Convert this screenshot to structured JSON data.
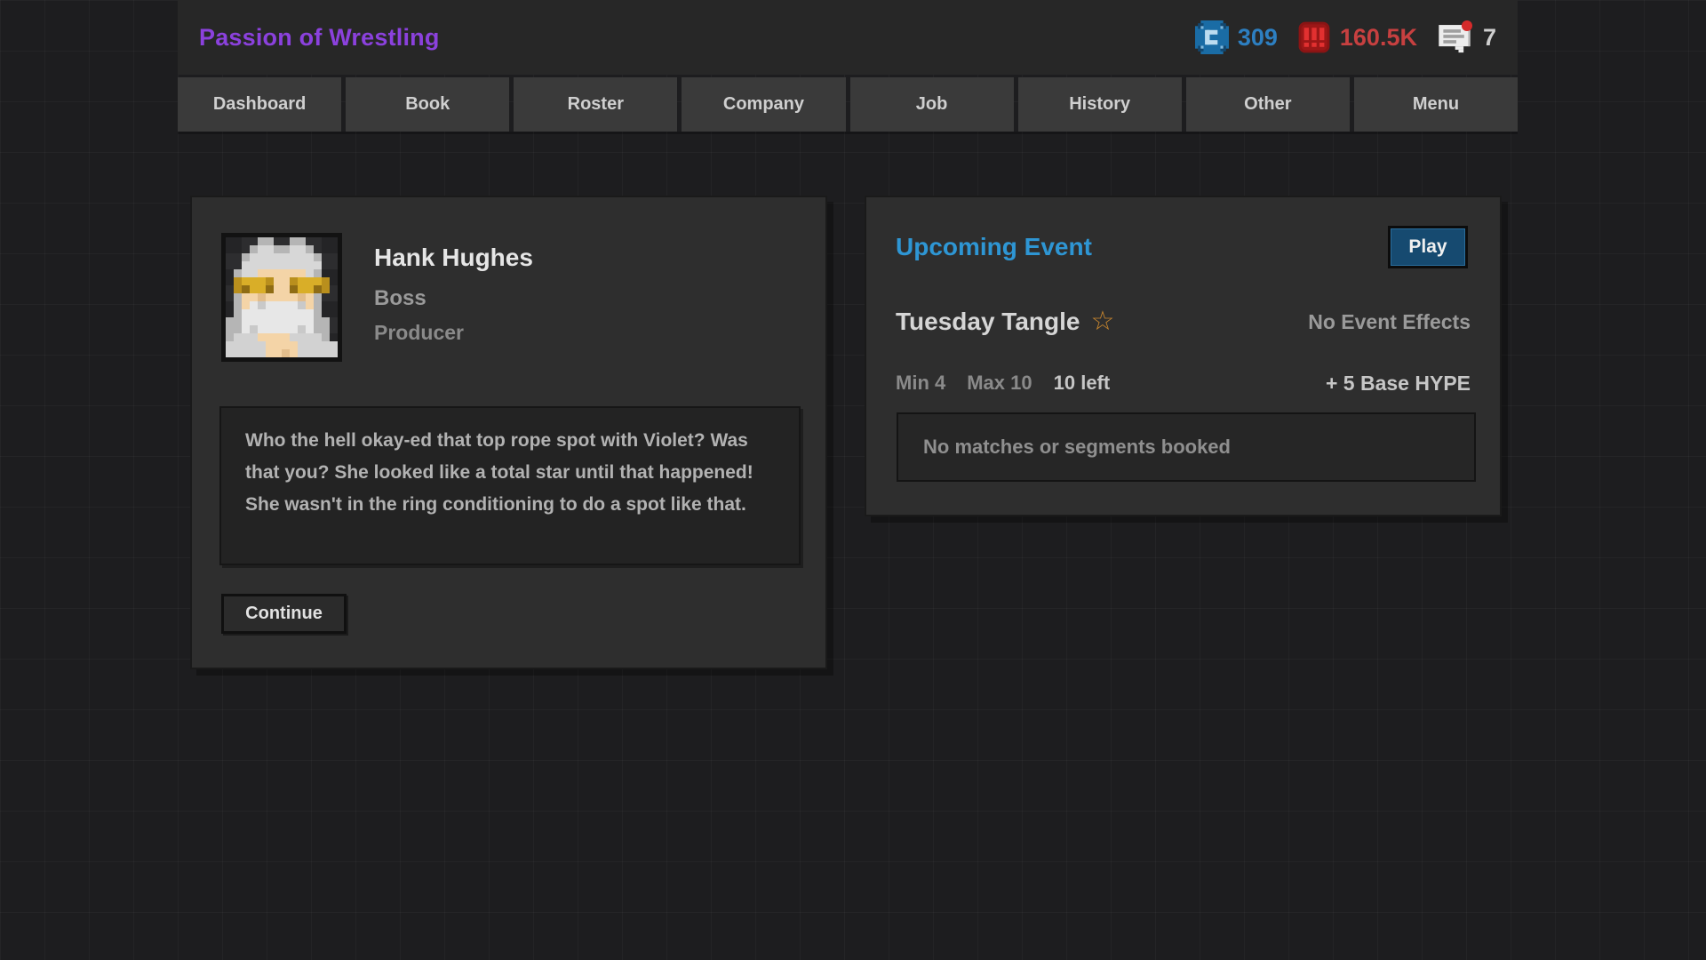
{
  "app": {
    "title": "Passion of Wrestling",
    "accent_purple": "#8b41dd",
    "accent_blue": "#2e96d4",
    "accent_red": "#c74040"
  },
  "header": {
    "tabs": [
      "Dashboard",
      "Book",
      "Roster",
      "Company",
      "Job",
      "History",
      "Other",
      "Menu"
    ],
    "stats": {
      "coins": {
        "icon": "coin-icon",
        "value": "309",
        "color": "#2d7fc1"
      },
      "hype": {
        "icon": "hype-icon",
        "value": "160.5K",
        "color": "#c74040"
      },
      "messages": {
        "icon": "messages-icon",
        "value": "7",
        "color": "#cfcfcf"
      }
    }
  },
  "dialogue_card": {
    "character": {
      "name": "Hank Hughes",
      "role": "Boss",
      "job": "Producer"
    },
    "message": "Who the hell okay-ed that top rope spot with Violet? Was that you? She looked like a total star until that happened! She wasn't in the ring conditioning to do a spot like that.",
    "continue_label": "Continue",
    "avatar": {
      "palette": {
        "h": "#b5b5b5",
        "H": "#d7d7d7",
        "s": "#f4d4a7",
        "S": "#e2bd8c",
        "g": "#b98f1d",
        "G": "#d9ae28",
        "o": "#8f6c14",
        "b": "#e7e7e7",
        "B": "#c9c9c9",
        "w": "#d2d2d2"
      },
      "pixels": [
        "....hh..hh....",
        "...hHHhhHHh...",
        "..hHHHHHHHHh..",
        "..HHHHHHHHHH..",
        ".hHHssssssHh..",
        ".gGGGgssgGGGg.",
        ".goGGossoGGog.",
        ".hssSssssSsh..",
        ".hsbBbbbbBsh..",
        ".hbbbbbbbbbh..",
        "hhbbbbbbbbbhh.",
        "hhbBbbbbbBbhh.",
        "hwwwsssswwwwh.",
        "wwwwwsssswwwww",
        "wwwwwssSswwwww"
      ]
    }
  },
  "event_card": {
    "title": "Upcoming Event",
    "play_label": "Play",
    "event_name": "Tuesday Tangle",
    "star_icon": "☆",
    "effects_label": "No Event Effects",
    "min_label": "Min 4",
    "max_label": "Max 10",
    "slots_left": "10 left",
    "hype_label": "+ 5 Base HYPE",
    "booking_empty": "No matches or segments booked"
  }
}
